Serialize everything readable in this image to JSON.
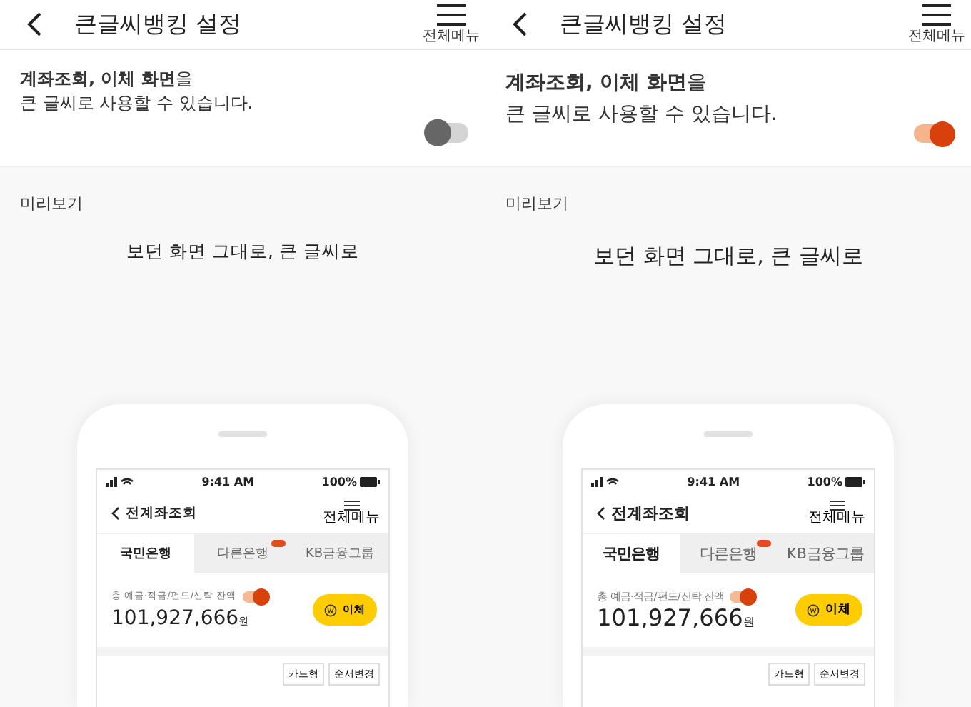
{
  "panels": [
    {
      "header": {
        "title": "큰글씨뱅킹 설정",
        "menu_label": "전체메뉴"
      },
      "setting": {
        "line1": "**계좌조회, 이체 화면**을",
        "line2": "큰 글씨로 사용할 수 있습니다.",
        "on": false
      },
      "preview_label": "미리보기",
      "caption": "보던 화면 그대로, 큰 글씨로",
      "phone": {
        "time": "9:41 AM",
        "battery": "100%",
        "title": "전계좌조회",
        "menu_label": "전체메뉴",
        "tabs": [
          {
            "label": "국민은행",
            "selected": true,
            "new": false
          },
          {
            "label": "다른은행",
            "selected": false,
            "new": true
          },
          {
            "label": "KB금융그룹",
            "selected": false,
            "new": false
          }
        ],
        "balance_label": "총 예금·적금/펀드/신탁 잔액",
        "balance_toggle_on": true,
        "amount": "101,927,666",
        "unit": "원",
        "transfer": "이체",
        "actions": [
          "카드형",
          "순서변경"
        ]
      }
    },
    {
      "header": {
        "title": "큰글씨뱅킹 설정",
        "menu_label": "전체메뉴"
      },
      "setting": {
        "line1": "**계좌조회, 이체 화면**을",
        "line2": "큰 글씨로 사용할 수 있습니다.",
        "on": true
      },
      "preview_label": "미리보기",
      "caption": "보던 화면 그대로, 큰 글씨로",
      "phone": {
        "time": "9:41 AM",
        "battery": "100%",
        "title": "전계좌조회",
        "menu_label": "전체메뉴",
        "tabs": [
          {
            "label": "국민은행",
            "selected": true,
            "new": false
          },
          {
            "label": "다른은행",
            "selected": false,
            "new": true
          },
          {
            "label": "KB금융그룹",
            "selected": false,
            "new": false
          }
        ],
        "balance_label": "총 예금·적금/펀드/신탁 잔액",
        "balance_toggle_on": true,
        "amount": "101,927,666",
        "unit": "원",
        "transfer": "이체",
        "actions": [
          "카드형",
          "순서변경"
        ]
      }
    }
  ]
}
